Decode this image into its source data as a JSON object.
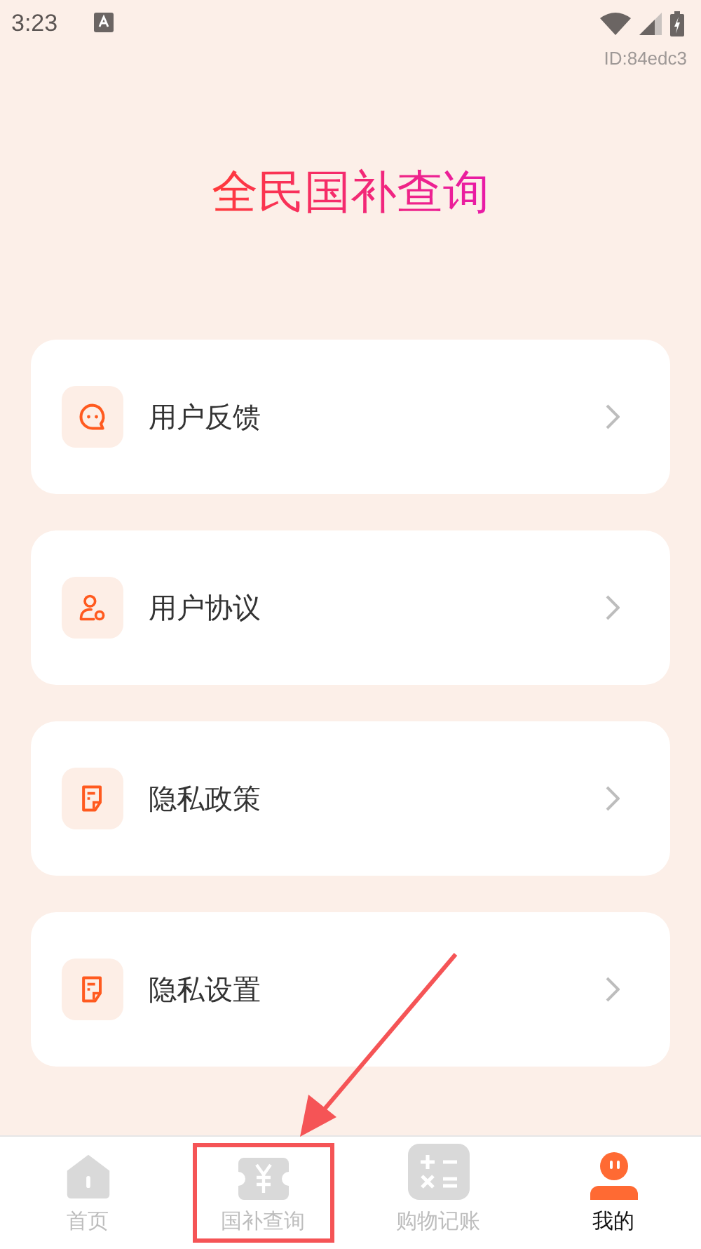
{
  "status_bar": {
    "time": "3:23"
  },
  "id_label": "ID:84edc3",
  "title": "全民国补查询",
  "menu": [
    {
      "label": "用户反馈",
      "kind": "chat"
    },
    {
      "label": "用户协议",
      "kind": "user"
    },
    {
      "label": "隐私政策",
      "kind": "doc"
    },
    {
      "label": "隐私设置",
      "kind": "doc"
    }
  ],
  "tabs": [
    {
      "label": "首页",
      "kind": "home",
      "selected": false
    },
    {
      "label": "国补查询",
      "kind": "coupon",
      "selected": false
    },
    {
      "label": "购物记账",
      "kind": "calc",
      "selected": false
    },
    {
      "label": "我的",
      "kind": "me",
      "selected": true
    }
  ]
}
